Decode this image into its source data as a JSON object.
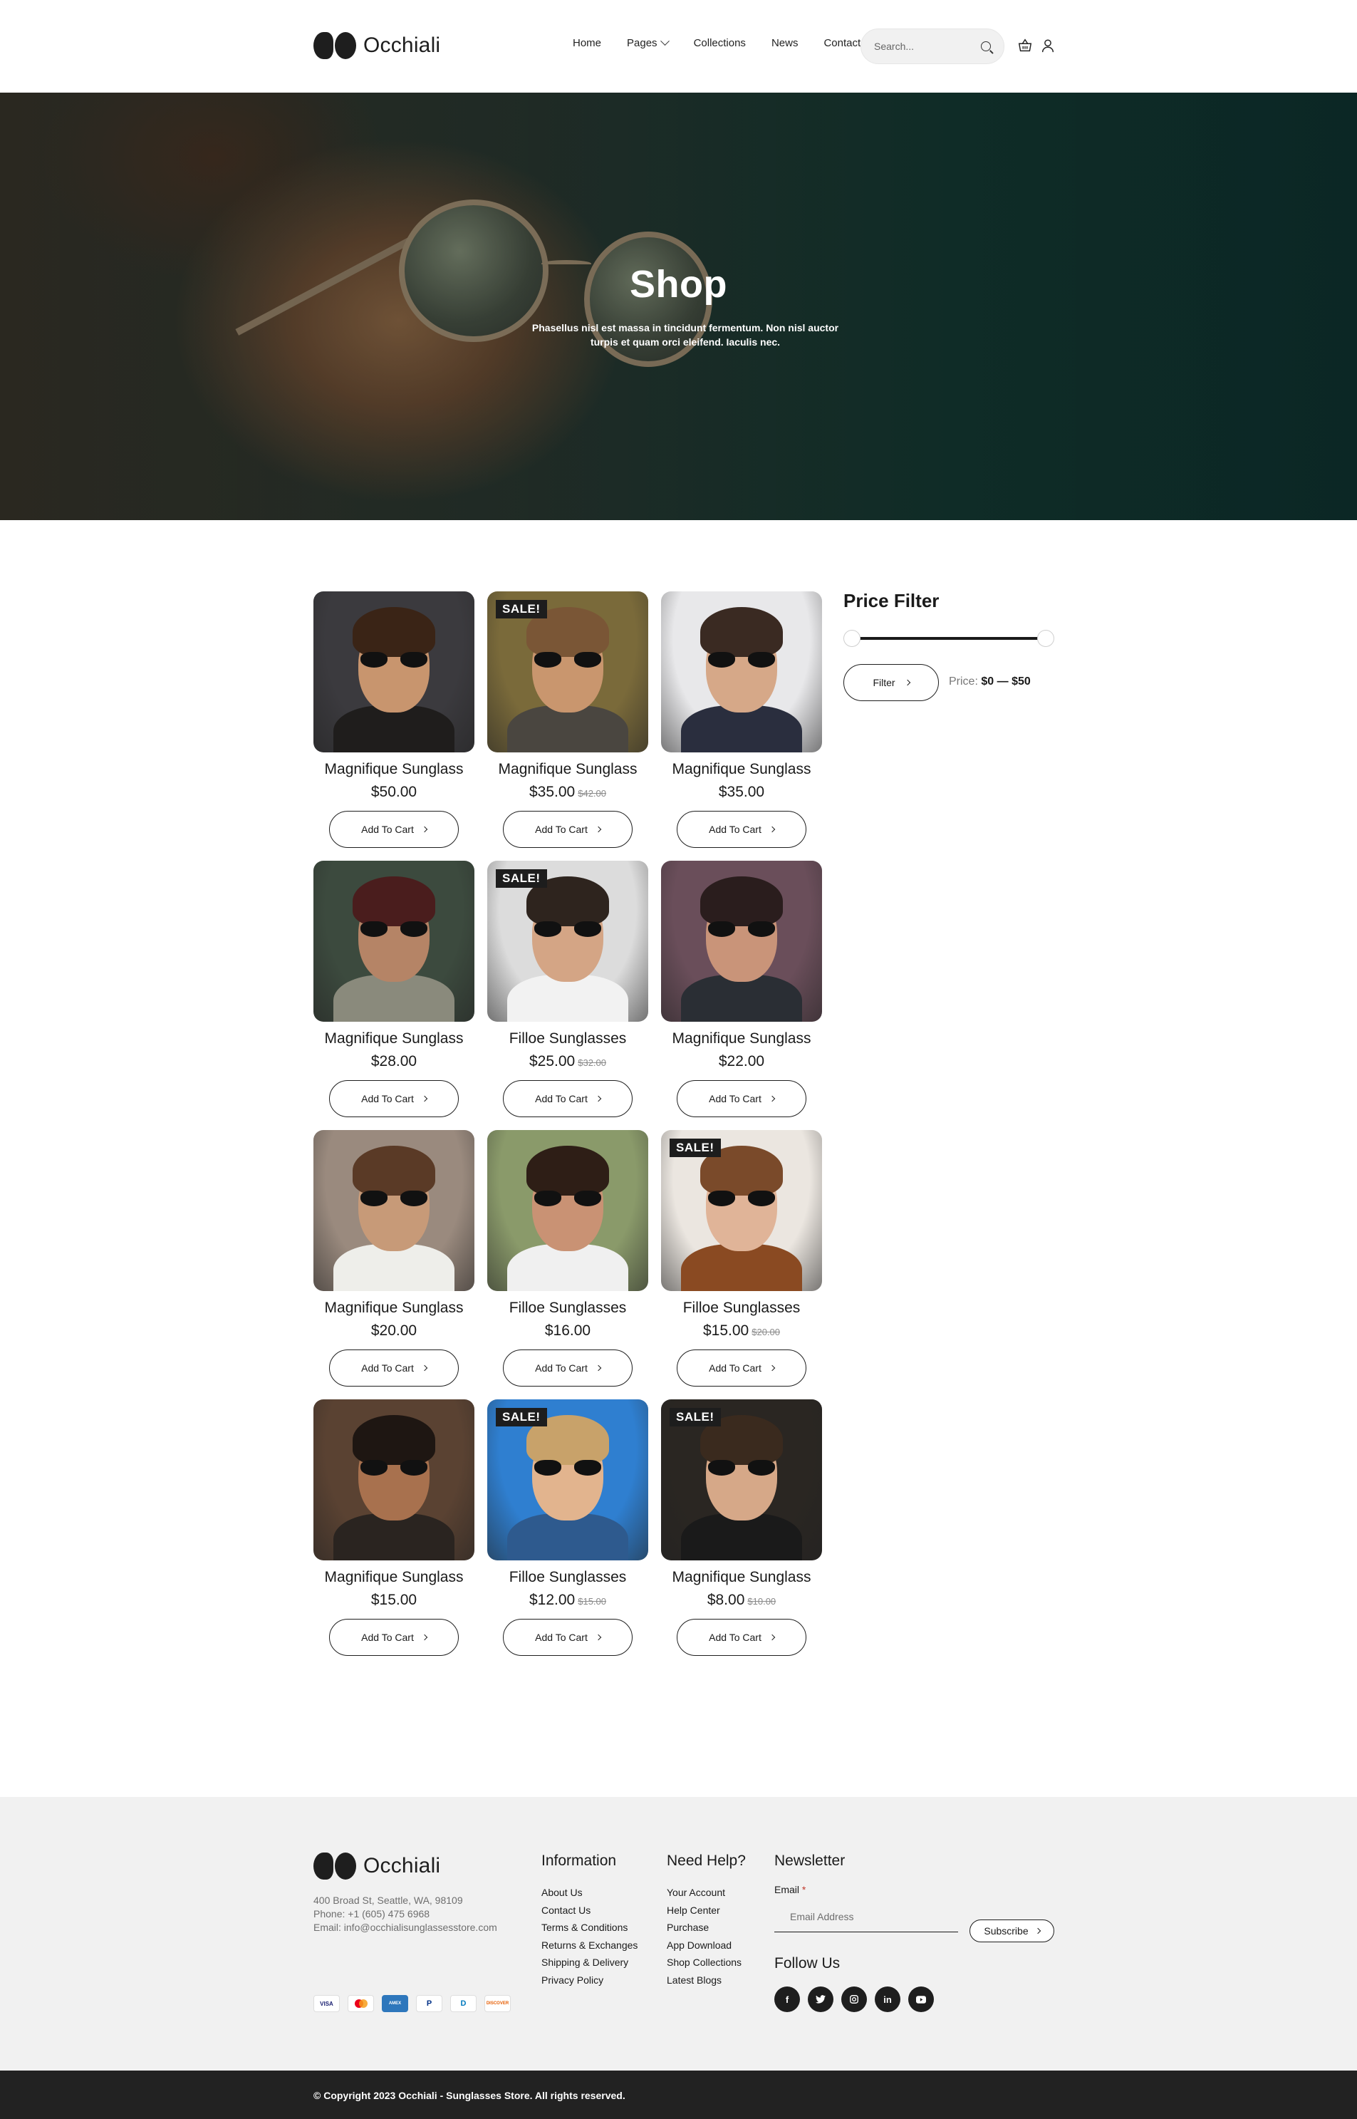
{
  "header": {
    "logo_text": "Occhiali",
    "nav": [
      "Home",
      "Pages",
      "Collections",
      "News",
      "Contact"
    ],
    "search_placeholder": "Search..."
  },
  "hero": {
    "title": "Shop",
    "subtitle": "Phasellus nisl est massa in tincidunt fermentum. Non nisl auctor turpis et quam orci eleifend. Iaculis nec."
  },
  "products": [
    {
      "name": "Magnifique Sunglass",
      "price": "$50.00",
      "old_price": "",
      "sale": "",
      "button": "Add To Cart",
      "colors": {
        "bg": "#3b3a3e",
        "skin": "#c8956e",
        "hair": "#3a2416",
        "body": "#1f1d1c"
      }
    },
    {
      "name": "Magnifique Sunglass",
      "price": "$35.00",
      "old_price": "$42.00",
      "sale": "SALE!",
      "button": "Add To Cart",
      "colors": {
        "bg": "#7a6a3a",
        "skin": "#c9966e",
        "hair": "#7a5636",
        "body": "#4a4640"
      }
    },
    {
      "name": "Magnifique Sunglass",
      "price": "$35.00",
      "old_price": "",
      "sale": "",
      "button": "Add To Cart",
      "colors": {
        "bg": "#e8e8ea",
        "skin": "#d6a888",
        "hair": "#3a2a22",
        "body": "#2a2e3e"
      }
    },
    {
      "name": "Magnifique Sunglass",
      "price": "$28.00",
      "old_price": "",
      "sale": "",
      "button": "Add To Cart",
      "colors": {
        "bg": "#3c4a3e",
        "skin": "#b58466",
        "hair": "#4a1d1d",
        "body": "#8a8a7c"
      }
    },
    {
      "name": "Filloe Sunglasses",
      "price": "$25.00",
      "old_price": "$32.00",
      "sale": "SALE!",
      "button": "Add To Cart",
      "colors": {
        "bg": "#dcdcdc",
        "skin": "#d4a585",
        "hair": "#2e241e",
        "body": "#f2f2f2"
      }
    },
    {
      "name": "Magnifique Sunglass",
      "price": "$22.00",
      "old_price": "",
      "sale": "",
      "button": "Add To Cart",
      "colors": {
        "bg": "#6a4e5a",
        "skin": "#c99479",
        "hair": "#2a1d1d",
        "body": "#2a2e34"
      }
    },
    {
      "name": "Magnifique Sunglass",
      "price": "$20.00",
      "old_price": "",
      "sale": "",
      "button": "Add To Cart",
      "colors": {
        "bg": "#9a8a7e",
        "skin": "#c79a78",
        "hair": "#5a3a26",
        "body": "#eeeeea"
      }
    },
    {
      "name": "Filloe Sunglasses",
      "price": "$16.00",
      "old_price": "",
      "sale": "",
      "button": "Add To Cart",
      "colors": {
        "bg": "#8a9a6a",
        "skin": "#c99274",
        "hair": "#2e1e16",
        "body": "#f0f0f0"
      }
    },
    {
      "name": "Filloe Sunglasses",
      "price": "$15.00",
      "old_price": "$20.00",
      "sale": "SALE!",
      "button": "Add To Cart",
      "colors": {
        "bg": "#ebe6e0",
        "skin": "#e0b498",
        "hair": "#7a4a2a",
        "body": "#8a4a22"
      }
    },
    {
      "name": "Magnifique Sunglass",
      "price": "$15.00",
      "old_price": "",
      "sale": "",
      "button": "Add To Cart",
      "colors": {
        "bg": "#5a4232",
        "skin": "#a8714e",
        "hair": "#1e1612",
        "body": "#2a2420"
      }
    },
    {
      "name": "Filloe Sunglasses",
      "price": "$12.00",
      "old_price": "$15.00",
      "sale": "SALE!",
      "button": "Add To Cart",
      "colors": {
        "bg": "#2f7fd0",
        "skin": "#e2b48e",
        "hair": "#c8a26a",
        "body": "#2e5a8e"
      }
    },
    {
      "name": "Magnifique Sunglass",
      "price": "$8.00",
      "old_price": "$10.00",
      "sale": "SALE!",
      "button": "Add To Cart",
      "colors": {
        "bg": "#2a2622",
        "skin": "#d6a888",
        "hair": "#3a2a1e",
        "body": "#1a1a1a"
      }
    }
  ],
  "filter": {
    "title": "Price Filter",
    "button": "Filter",
    "price_label": "Price:",
    "min": "$0",
    "separator": "—",
    "max": "$50"
  },
  "footer": {
    "logo_text": "Occhiali",
    "address": "400 Broad St, Seattle, WA, 98109",
    "phone": "Phone: +1 (605) 475 6968",
    "email": "Email: info@occhialisunglassesstore.com",
    "payments": [
      "VISA",
      "MC",
      "AMEX",
      "P",
      "D",
      "DISCOVER"
    ],
    "information": {
      "title": "Information",
      "links": [
        "About Us",
        "Contact Us",
        "Terms & Conditions",
        "Returns & Exchanges",
        "Shipping & Delivery",
        "Privacy Policy"
      ]
    },
    "help": {
      "title": "Need Help?",
      "links": [
        "Your Account",
        "Help Center",
        "Purchase",
        "App Download",
        "Shop Collections",
        "Latest Blogs"
      ]
    },
    "newsletter": {
      "title": "Newsletter",
      "email_label": "Email",
      "required": "*",
      "email_placeholder": "Email Address",
      "subscribe": "Subscribe",
      "follow_title": "Follow Us",
      "socials": [
        "f",
        "t",
        "ig",
        "in",
        "yt"
      ]
    },
    "copyright": "© Copyright 2023 Occhiali - Sunglasses Store. All rights reserved."
  }
}
